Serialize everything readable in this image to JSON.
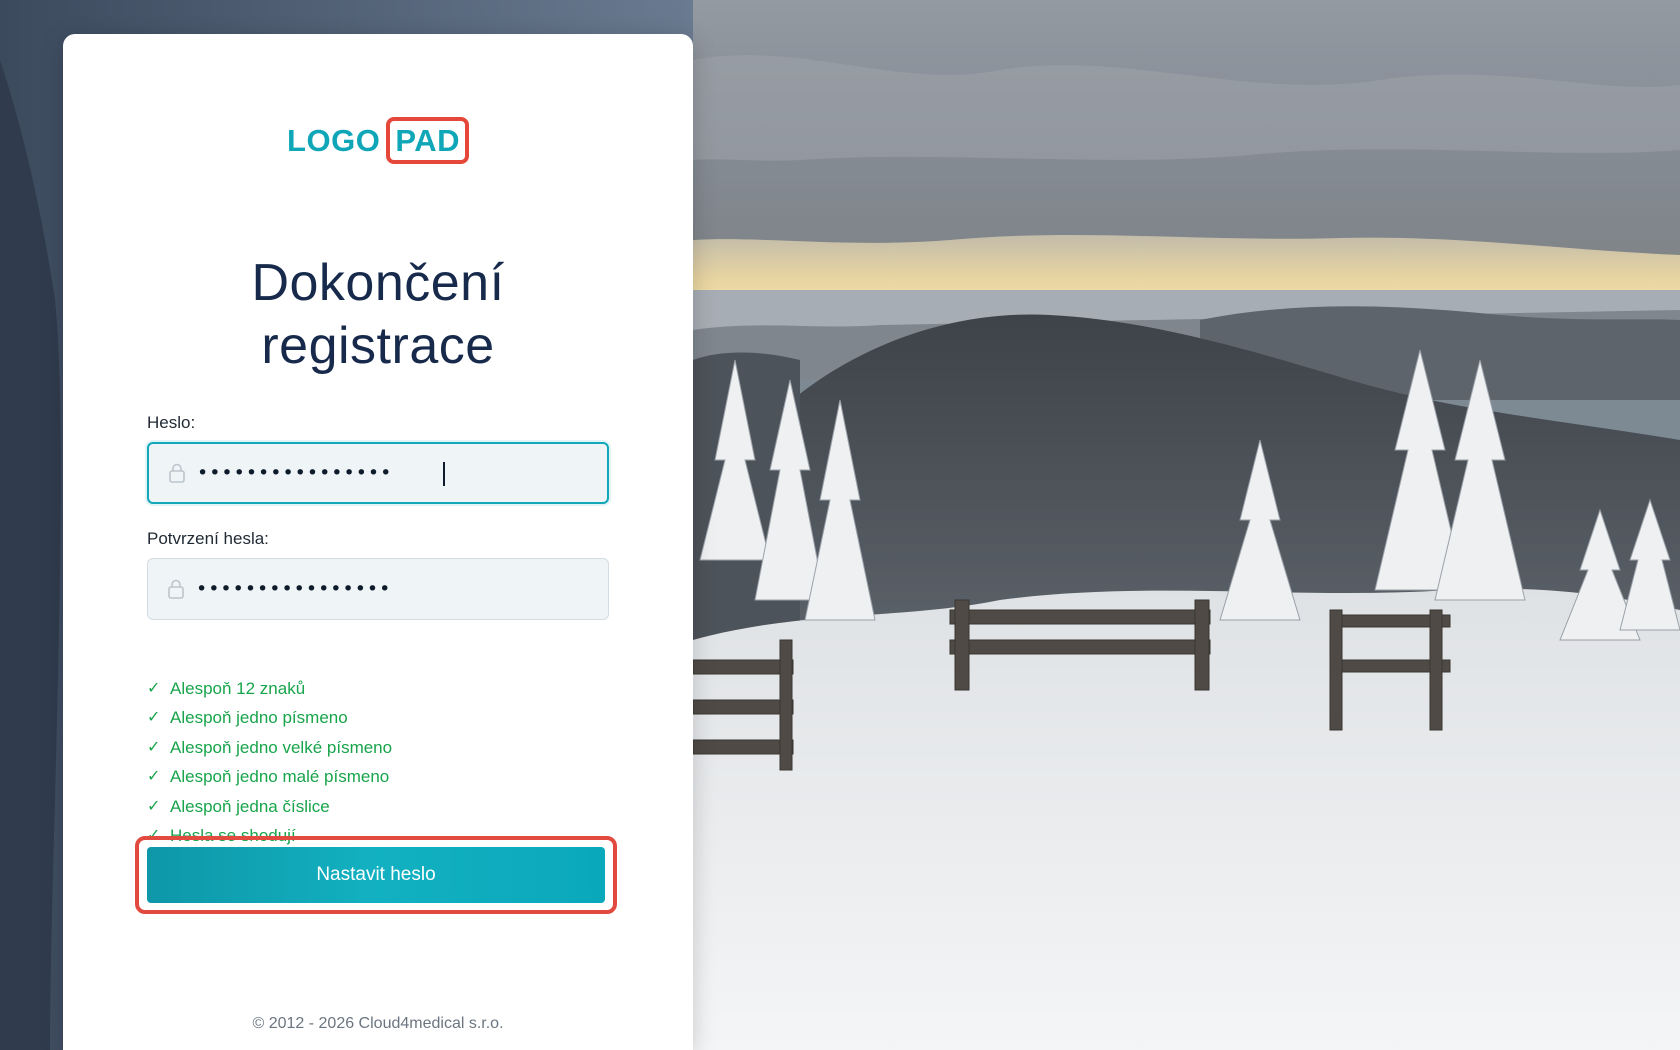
{
  "logo": {
    "word": "LOGO",
    "pad": "PAD"
  },
  "title": {
    "line1": "Dokončení",
    "line2": "registrace"
  },
  "password": {
    "label": "Heslo:",
    "value": "••••••••••••••••"
  },
  "confirm": {
    "label": "Potvrzení hesla:",
    "value": "••••••••••••••••"
  },
  "requirements": [
    "Alespoň 12 znaků",
    "Alespoň jedno písmeno",
    "Alespoň jedno velké písmeno",
    "Alespoň jedno malé písmeno",
    "Alespoň jedna číslice",
    "Hesla se shodují"
  ],
  "check_glyph": "✓",
  "submit_label": "Nastavit heslo",
  "footer": "© 2012 - 2026 Cloud4medical s.r.o.",
  "colors": {
    "accent": "#12a8b9",
    "highlight": "#e24a3f",
    "success": "#18a44b",
    "title": "#172a4b"
  }
}
